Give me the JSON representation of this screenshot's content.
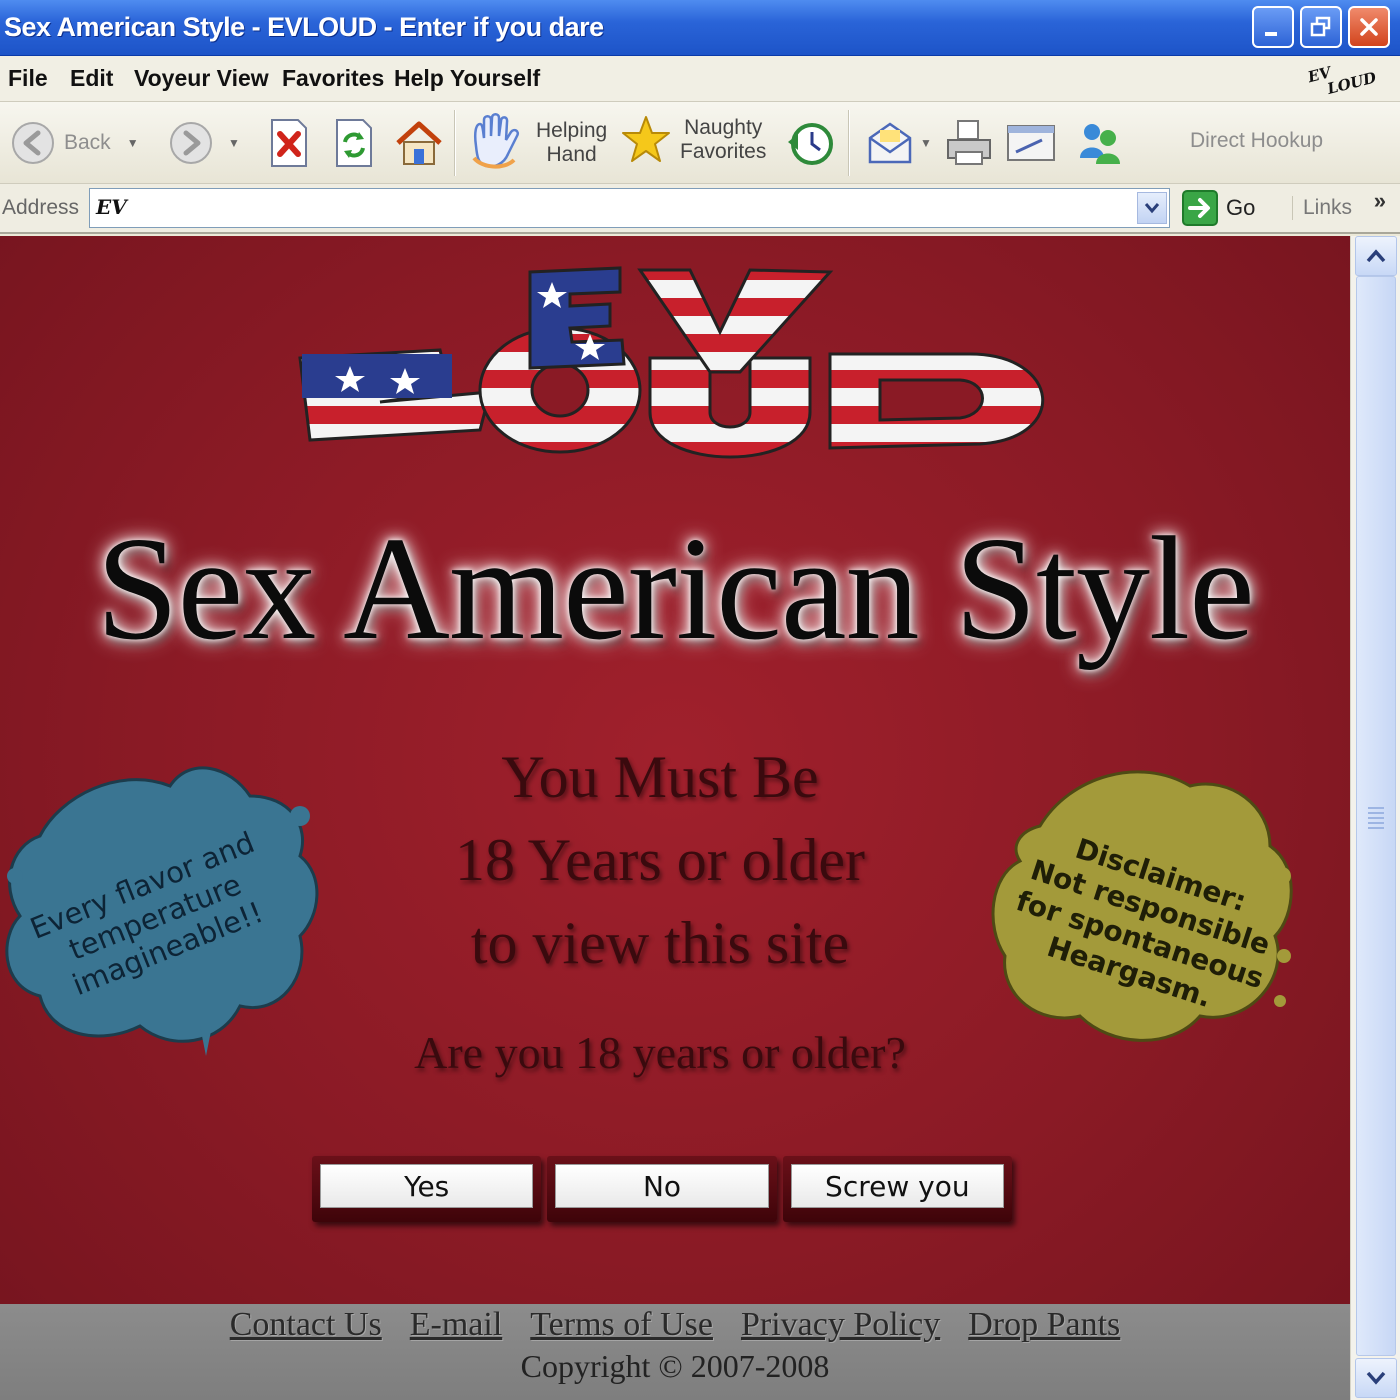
{
  "window": {
    "title": "Sex American Style - EVLOUD - Enter if you dare",
    "controls": [
      "minimize-icon",
      "restore-icon",
      "close-icon"
    ]
  },
  "menu": {
    "items": [
      "File",
      "Edit",
      "Voyeur View",
      "Favorites",
      "Help Yourself"
    ],
    "brand_mark_line1": "EV",
    "brand_mark_line2": "LOUD"
  },
  "toolbar": {
    "back_label": "Back",
    "helping_hand_line1": "Helping",
    "helping_hand_line2": "Hand",
    "naughty_favorites_line1": "Naughty",
    "naughty_favorites_line2": "Favorites",
    "direct_hookup_label": "Direct Hookup",
    "icons": [
      "back-arrow-icon",
      "forward-arrow-icon",
      "stop-icon",
      "refresh-icon",
      "home-icon",
      "hand-icon",
      "star-icon",
      "history-icon",
      "mail-icon",
      "print-icon",
      "edit-icon",
      "messenger-icon"
    ]
  },
  "address": {
    "label": "Address",
    "value": "EV",
    "go_label": "Go",
    "links_label": "Links",
    "more_label": "»"
  },
  "page": {
    "logo_text": "EV LOUD",
    "headline": "Sex American Style",
    "warning_line1": "You Must Be",
    "warning_line2": "18 Years or older",
    "warning_line3": "to view this site",
    "question": "Are you 18 years or older?",
    "left_splat": {
      "line1": "Every flavor and",
      "line2": "temperature",
      "line3": "imagineable!!",
      "color": "#3a7592"
    },
    "right_splat": {
      "line1": "Disclaimer:",
      "line2": "Not responsible",
      "line3": "for spontaneous",
      "line4": "Heargasm.",
      "color": "#a39a3a"
    },
    "buttons": {
      "yes": "Yes",
      "no": "No",
      "screw_you": "Screw you"
    },
    "background_color": "#8a1a25"
  },
  "footer": {
    "links": [
      "Contact Us",
      "E-mail",
      "Terms of Use",
      "Privacy Policy",
      "Drop Pants"
    ],
    "copyright": "Copyright © 2007-2008"
  }
}
